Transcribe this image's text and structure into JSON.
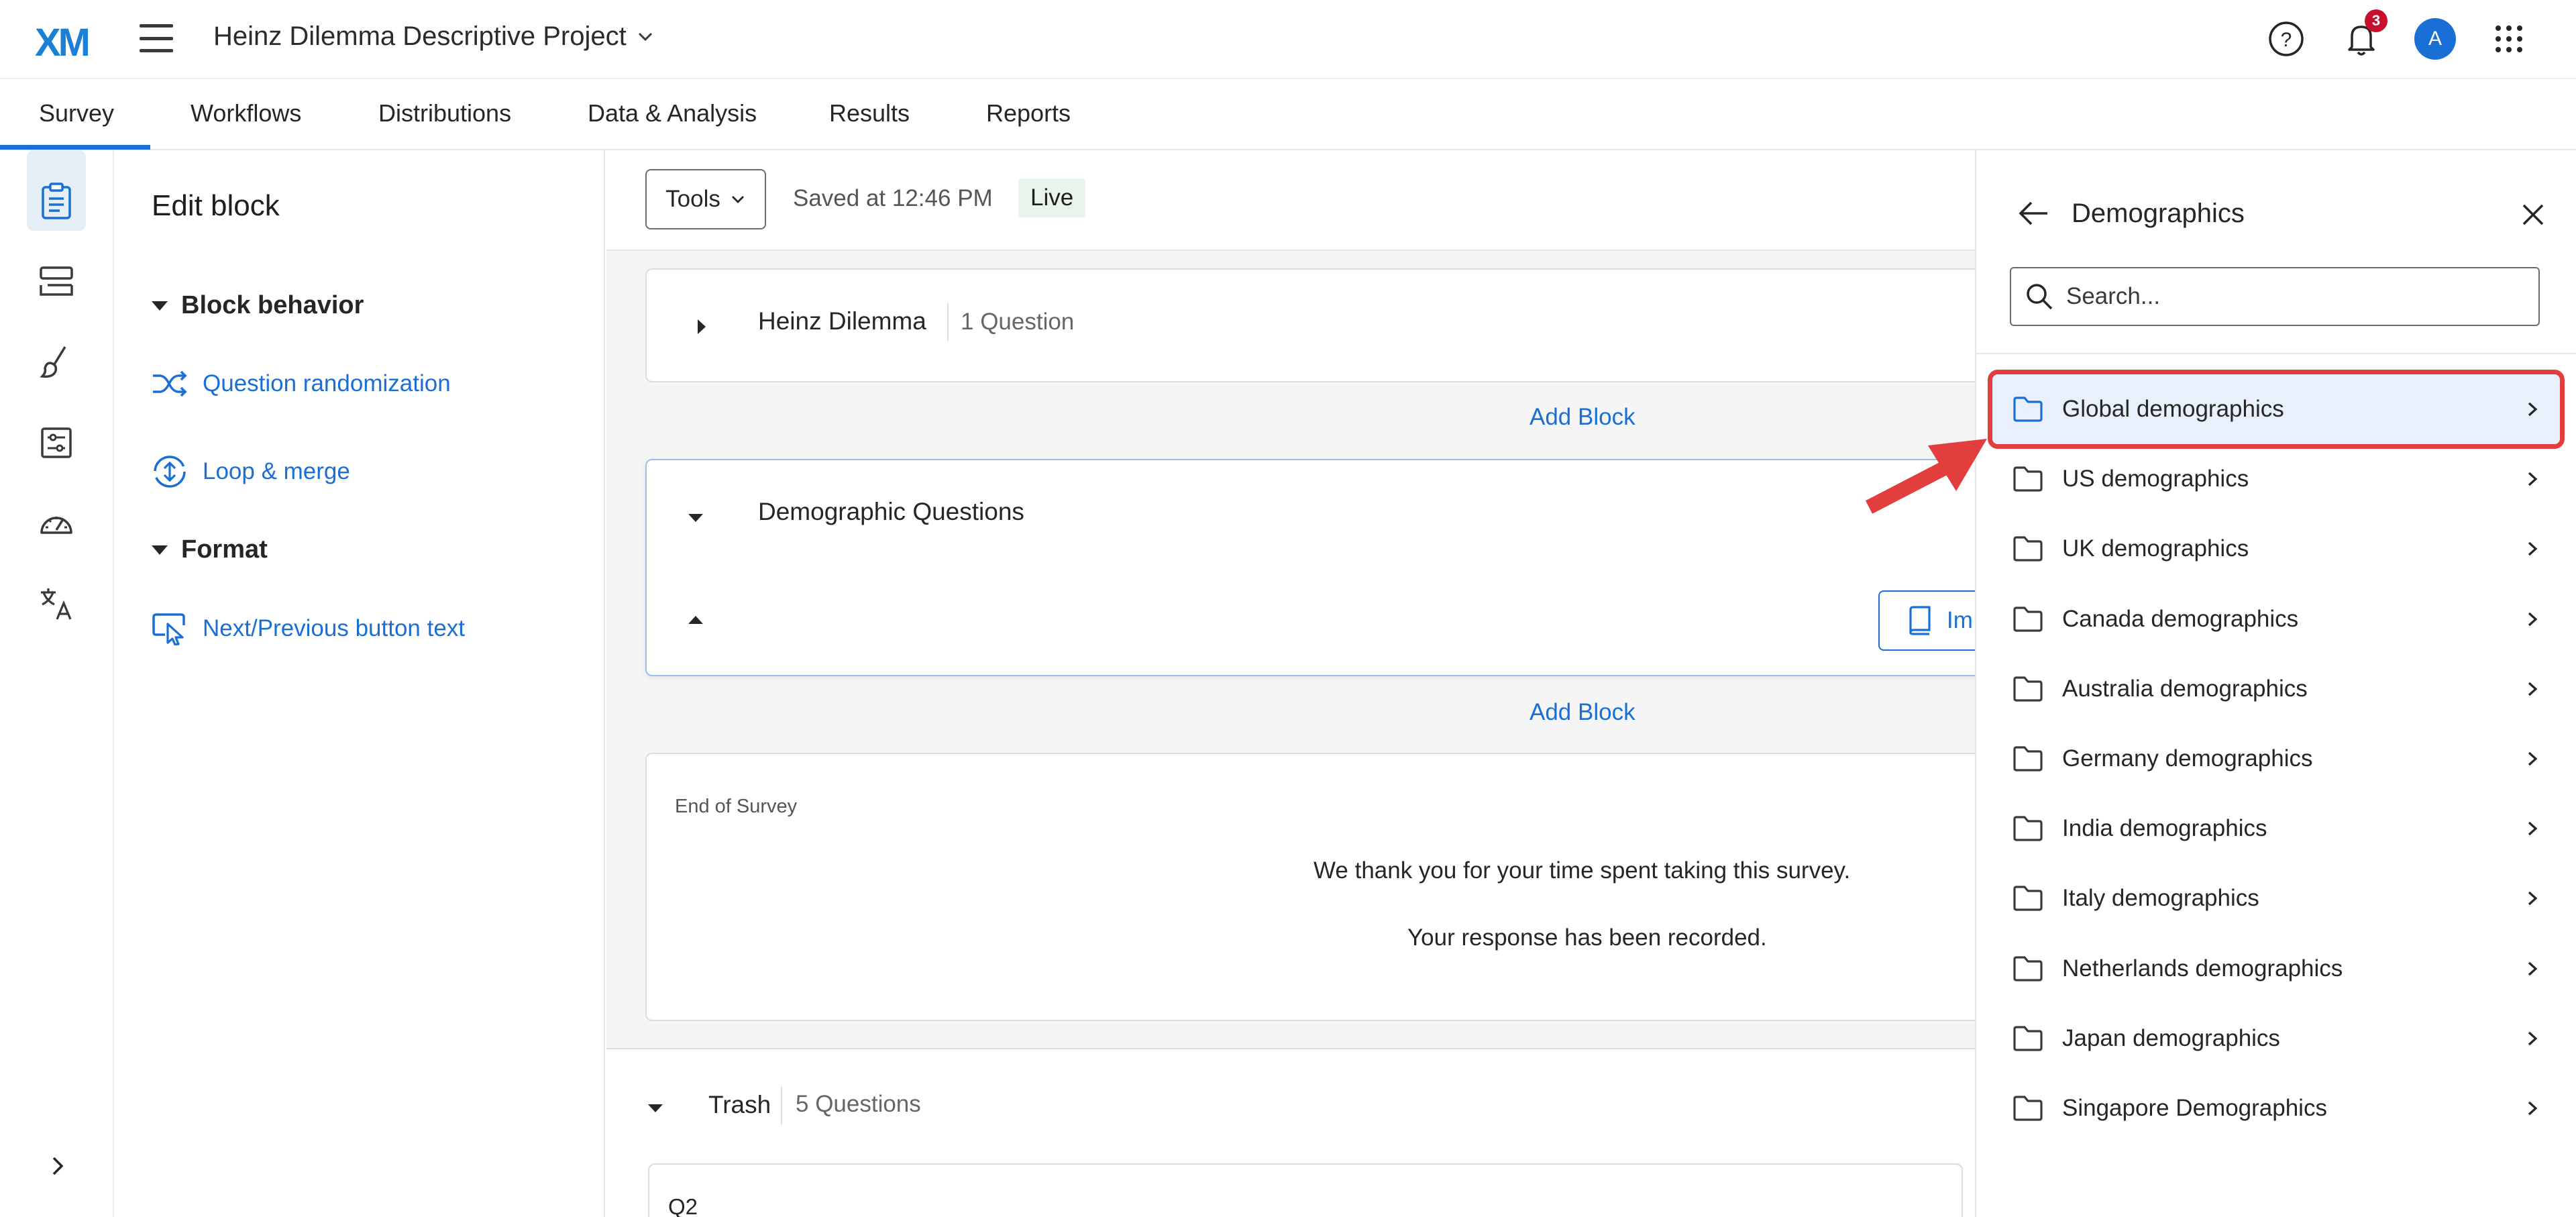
{
  "header": {
    "logo": "XM",
    "project_title": "Heinz Dilemma Descriptive Project",
    "notification_count": "3",
    "avatar_initial": "A"
  },
  "tabs": [
    {
      "label": "Survey",
      "active": true
    },
    {
      "label": "Workflows"
    },
    {
      "label": "Distributions"
    },
    {
      "label": "Data & Analysis"
    },
    {
      "label": "Results"
    },
    {
      "label": "Reports"
    }
  ],
  "rail_icons": [
    "survey-icon",
    "blocks-icon",
    "brush-icon",
    "options-icon",
    "gauge-icon",
    "translate-icon"
  ],
  "edit_panel": {
    "title": "Edit block",
    "block_behavior_heading": "Block behavior",
    "question_randomization": "Question randomization",
    "loop_merge": "Loop & merge",
    "format_heading": "Format",
    "next_prev_text": "Next/Previous button text"
  },
  "toolbar": {
    "tools_label": "Tools",
    "saved_text": "Saved at 12:46 PM",
    "live_label": "Live"
  },
  "blocks": {
    "heinz": {
      "name": "Heinz Dilemma",
      "count": "1 Question"
    },
    "add_block_1": "Add Block",
    "demographic": {
      "name": "Demographic Questions",
      "import_label": "Im"
    },
    "add_block_2": "Add Block",
    "end_of_survey": {
      "label": "End of Survey",
      "line1": "We thank you for your time spent taking this survey.",
      "line2": "Your response has been recorded."
    },
    "trash": {
      "name": "Trash",
      "count": "5 Questions"
    },
    "q2_label": "Q2"
  },
  "right_panel": {
    "title": "Demographics",
    "search_placeholder": "Search...",
    "folders": [
      {
        "label": "Global demographics",
        "highlighted": true
      },
      {
        "label": "US demographics"
      },
      {
        "label": "UK demographics"
      },
      {
        "label": "Canada demographics"
      },
      {
        "label": "Australia demographics"
      },
      {
        "label": "Germany demographics"
      },
      {
        "label": "India demographics"
      },
      {
        "label": "Italy demographics"
      },
      {
        "label": "Netherlands demographics"
      },
      {
        "label": "Japan demographics"
      },
      {
        "label": "Singapore Demographics"
      }
    ]
  },
  "colors": {
    "accent": "#1a6fd6",
    "highlight_border": "#e23e3e",
    "badge": "#c8102e",
    "live_bg": "#e8f3ea"
  }
}
